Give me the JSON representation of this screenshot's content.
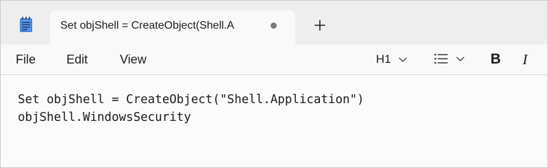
{
  "tab": {
    "title": "Set objShell = CreateObject(Shell.A"
  },
  "menu": {
    "file": "File",
    "edit": "Edit",
    "view": "View"
  },
  "toolbar": {
    "heading": "H1"
  },
  "editor": {
    "lines": [
      "Set objShell = CreateObject(\"Shell.Application\")",
      "objShell.WindowsSecurity"
    ]
  },
  "icons": {
    "app": "notepad-icon",
    "new_tab": "plus-icon",
    "unsaved": "unsaved-dot-icon",
    "heading_chevron": "chevron-down-icon",
    "list": "bulleted-list-icon",
    "bold": "bold-icon",
    "italic": "italic-icon"
  },
  "colors": {
    "accent": "#0f6cbd",
    "text": "#1b1b1b"
  }
}
